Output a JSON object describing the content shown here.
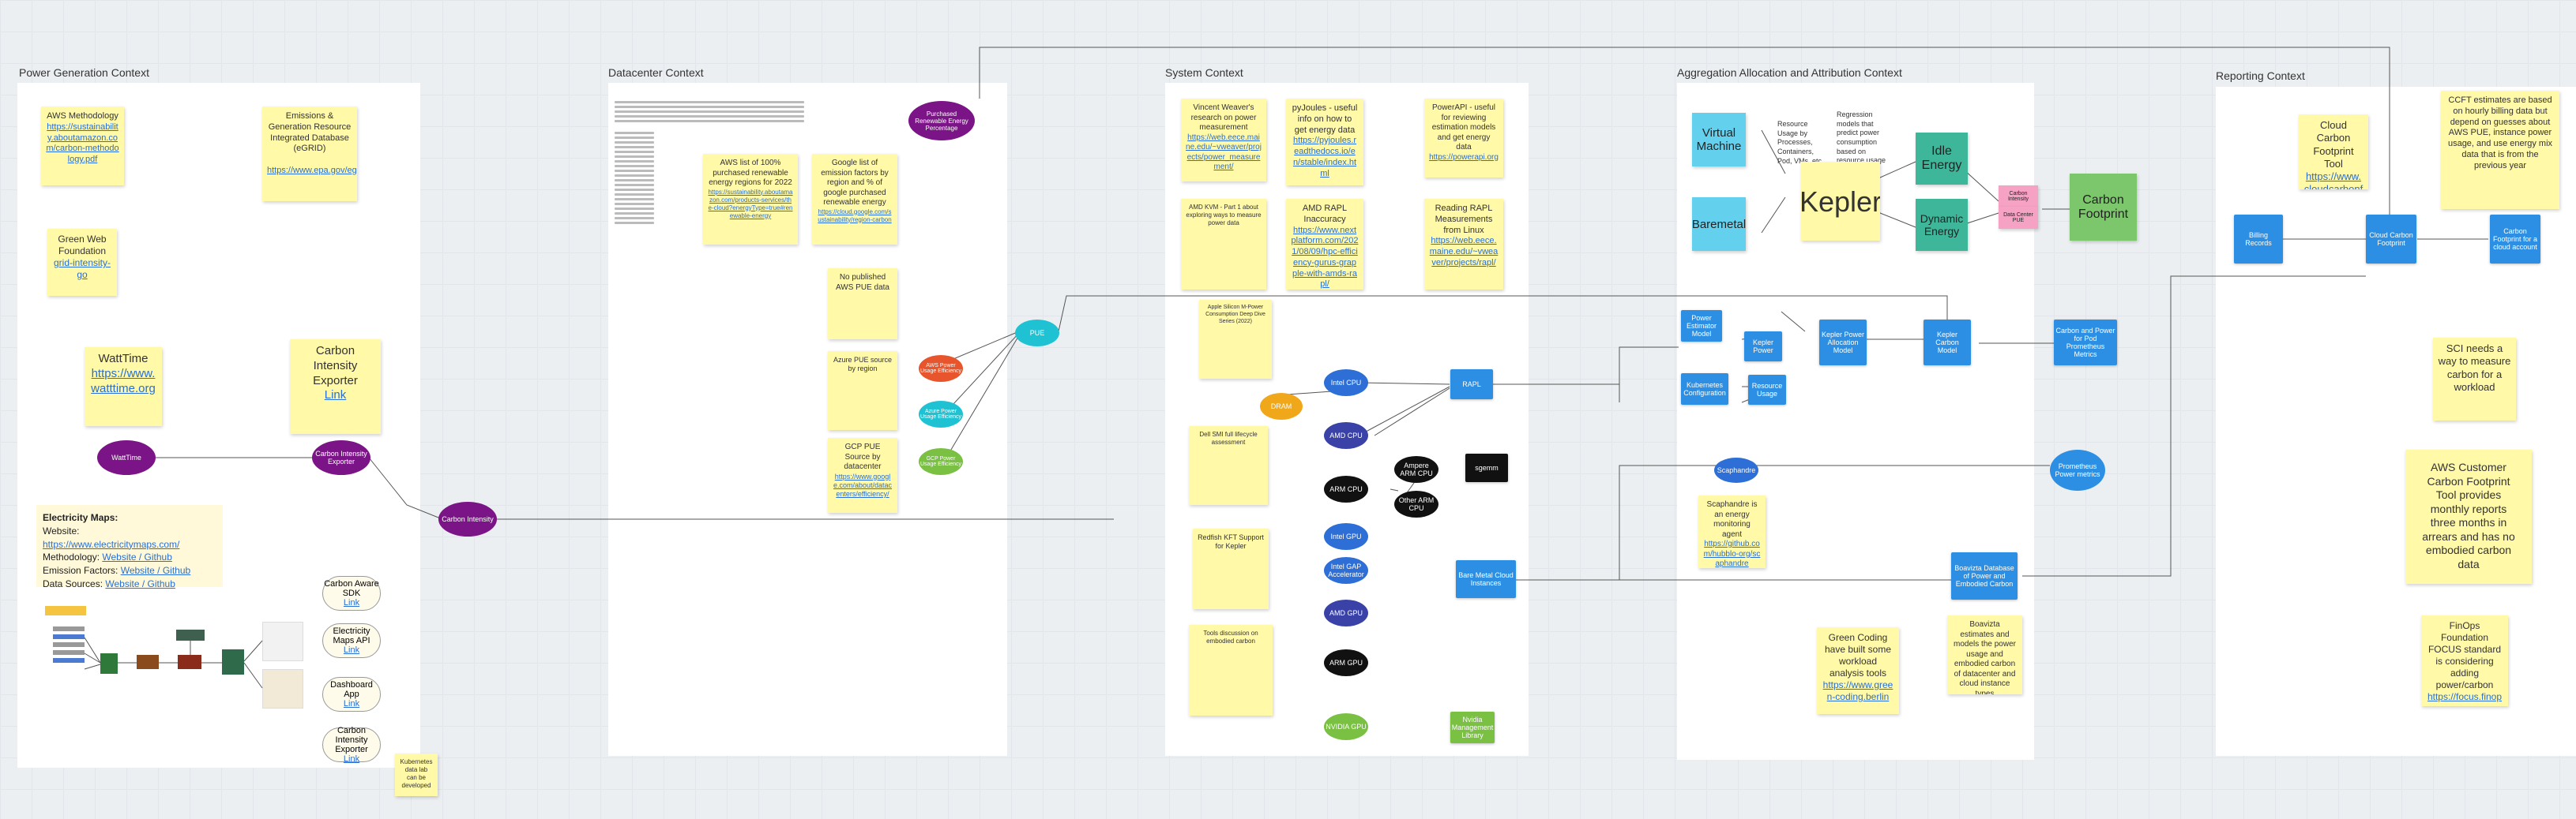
{
  "sections": {
    "power": "Power Generation Context",
    "datacenter": "Datacenter Context",
    "system": "System Context",
    "aggregation": "Aggregation Allocation and Attribution Context",
    "reporting": "Reporting Context"
  },
  "power_notes": {
    "aws_method_title": "AWS Methodology",
    "aws_method_link": "https://sustainability.aboutamazon.com/carbon-methodology.pdf",
    "egrid_title": "Emissions & Generation Resource Integrated Database (eGRID)",
    "egrid_link": "https://www.epa.gov/egrid",
    "gwf_title": "Green Web Foundation",
    "gwf_link": "grid-intensity-go",
    "watttime_title": "WattTime",
    "watttime_link": "https://www.watttime.org",
    "cie_title": "Carbon Intensity Exporter",
    "cie_link": "Link"
  },
  "power_nodes": {
    "watttime": "WattTime",
    "cie": "Carbon Intensity Exporter",
    "carbon_intensity": "Carbon Intensity"
  },
  "electricity_maps": {
    "title": "Electricity Maps:",
    "website_label": "Website:",
    "website_link": "https://www.electricitymaps.com/",
    "methodology_label": "Methodology:",
    "methodology_link": "Website / Github",
    "factors_label": "Emission Factors:",
    "factors_link": "Website / Github",
    "sources_label": "Data Sources:",
    "sources_link": "Website / Github"
  },
  "power_pills": [
    {
      "title": "Carbon Aware SDK",
      "link": "Link"
    },
    {
      "title": "Electricity Maps API",
      "link": "Link"
    },
    {
      "title": "Dashboard App",
      "link": "Link"
    },
    {
      "title": "Carbon Intensity Exporter",
      "link": "Link"
    }
  ],
  "k8s_note": "Kubernetes data lab can be developed",
  "dc_notes": {
    "aws_list": "AWS list of 100% purchased renewable energy regions for 2022",
    "aws_list_link": "https://sustainability.aboutamazon.com/products-services/the-cloud?energyType=true#renewable-energy",
    "google_list": "Google list of emission factors by region and % of google purchased renewable energy",
    "google_list_link": "https://cloud.google.com/sustainability/region-carbon",
    "no_pue": "No published AWS PUE data",
    "azure_pue": "Azure PUE source by region",
    "gcp_pue": "GCP PUE Source by datacenter",
    "gcp_pue_link": "https://www.google.com/about/datacenters/efficiency/"
  },
  "dc_nodes": {
    "purchased": "Purchased Renewable Energy Percentage",
    "red": "AWS Power Usage Efficiency",
    "teal": "Azure Power Usage Efficiency",
    "green": "GCP Power Usage Efficiency",
    "pue": "PUE"
  },
  "sys_notes": {
    "vw": "Vincent Weaver's research on power measurement",
    "vw_link": "https://web.eece.maine.edu/~vweaver/projects/power_measurement/",
    "pyjoules": "pyJoules - useful info on how to get energy data",
    "pyjoules_link": "https://pyjoules.readthedocs.io/en/stable/index.html",
    "powerapi": "PowerAPI - useful for reviewing estimation models and get energy data",
    "powerapi_link": "https://powerapi.org",
    "amd_rapl": "AMD RAPL Inaccuracy",
    "amd_rapl_link": "https://www.nextplatform.com/2021/08/09/hpc-efficiency-gurus-grapple-with-amds-rapl/",
    "reading_rapl": "Reading RAPL Measurements from Linux",
    "reading_rapl_link": "https://web.eece.maine.edu/~vweaver/projects/rapl/",
    "amd_kvm": "AMD KVM - Part 1 about exploring ways to measure power data",
    "apple": "Apple Silicon M-Power Consumption Deep Dive Series (2022)",
    "dell": "Dell SMI full lifecycle assessment",
    "redfish": "Redfish KFT Support for Kepler",
    "issue": "Tools discussion on embodied carbon"
  },
  "sys_nodes": {
    "intel_cpu": "Intel CPU",
    "amd_cpu": "AMD CPU",
    "arm_cpu": "ARM CPU",
    "ampere": "Ampere ARM CPU",
    "other_arm": "Other ARM CPU",
    "sgemm": "sgemm",
    "intel_gpu": "Intel GPU",
    "intel_gaudi": "Intel GAP Accelerator",
    "amd_gpu": "AMD GPU",
    "arm_gpu": "ARM GPU",
    "nvidia_gpu": "NVIDIA GPU",
    "nvidia_box": "Nvidia Management Library",
    "dram": "DRAM",
    "rapl": "RAPL",
    "bare_metal": "Bare Metal Cloud Instances"
  },
  "agg": {
    "vm": "Virtual Machine",
    "baremetal": "Baremetal",
    "resource_text": "Resource Usage by Processes, Containers, Pod, VMs, etc",
    "regression_text": "Regression models that predict power consumption based on resource usage",
    "kepler": "Kepler",
    "idle": "Idle Energy",
    "dynamic": "Dynamic Energy",
    "carbon_intensity": "Carbon Intensity",
    "dc_pue": "Data Center PUE",
    "carbon_footprint": "Carbon Footprint",
    "power_est": "Power Estimator Model",
    "kepler_power": "Kepler Power",
    "kepler_alloc": "Kepler Power Allocation Model",
    "kepler_carbon": "Kepler Carbon Model",
    "k8s_config": "Kubernetes Configuration",
    "resource_usage": "Resource Usage",
    "carbon_power_out": "Carbon and Power for Pod Prometheus Metrics",
    "scaphandre": "Scaphandre",
    "prometheus": "Prometheus Power metrics",
    "scaph_note": "Scaphandre is an energy monitoring agent",
    "scaph_link": "https://github.com/hubblo-org/scaphandre",
    "boavizta_box": "Boavizta Database of Power and Embodied Carbon",
    "green_coding": "Green Coding have built some workload analysis tools",
    "green_coding_link": "https://www.green-coding.berlin",
    "boavizta_note": "Boavizta estimates and models the power usage and embodied carbon of datacenter and cloud instance types"
  },
  "report": {
    "ccft_title": "Cloud Carbon Footprint Tool",
    "ccft_link": "https://www.cloudcarbonfootprint.org",
    "ccft_note": "CCFT estimates are based on hourly billing data but depend on guesses about AWS PUE, instance power usage, and use energy mix data that is from the previous year",
    "billing": "Billing Records",
    "ccft_box": "Cloud Carbon Footprint",
    "cf_box": "Carbon Footprint for a cloud account",
    "sci": "SCI needs a way to measure carbon for a workload",
    "aws_ccft": "AWS Customer Carbon Footprint Tool provides monthly reports three months in arrears and has no embodied carbon data",
    "finops": "FinOps Foundation FOCUS standard is considering adding power/carbon",
    "finops_link": "https://focus.finops.org"
  }
}
